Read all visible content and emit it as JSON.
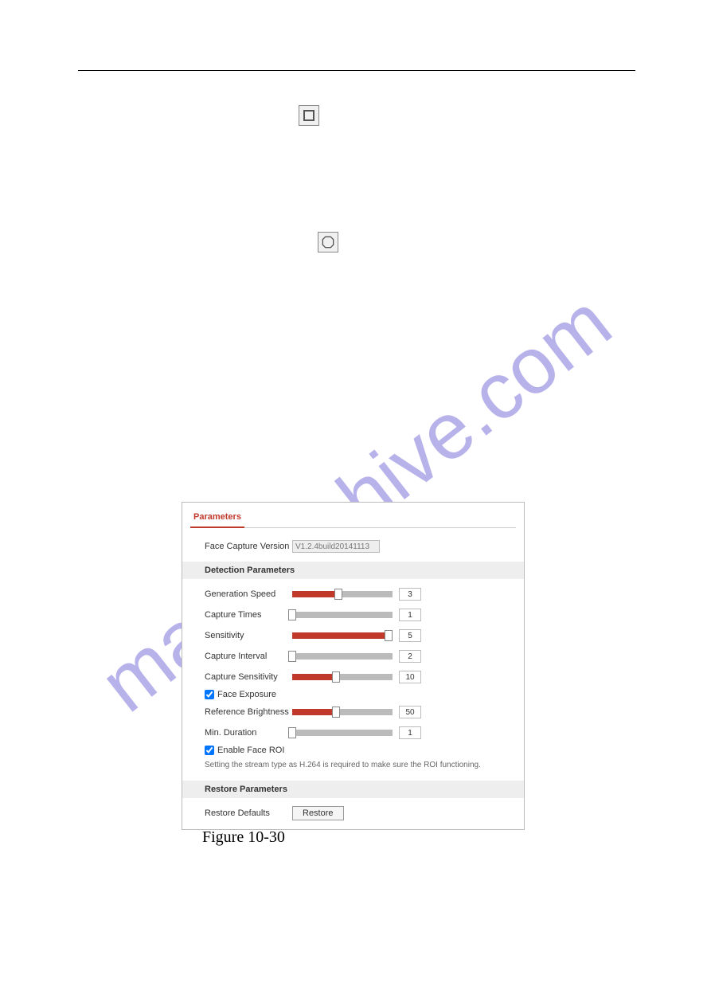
{
  "watermark": "manualshive.com",
  "icons": {
    "square_name": "stop-icon",
    "octagon_name": "octagon-icon"
  },
  "panel": {
    "tab_label": "Parameters",
    "version_label": "Face Capture Version",
    "version_value": "V1.2.4build20141113",
    "section_detection": "Detection Parameters",
    "section_restore": "Restore Parameters",
    "rows": {
      "generation_speed": {
        "label": "Generation Speed",
        "value": "3",
        "pct": 46
      },
      "capture_times": {
        "label": "Capture Times",
        "value": "1",
        "pct": 0
      },
      "sensitivity": {
        "label": "Sensitivity",
        "value": "5",
        "pct": 96
      },
      "capture_interval": {
        "label": "Capture Interval",
        "value": "2",
        "pct": 0
      },
      "capture_sensitivity": {
        "label": "Capture Sensitivity",
        "value": "10",
        "pct": 44
      },
      "reference_brightness": {
        "label": "Reference Brightness",
        "value": "50",
        "pct": 44
      },
      "min_duration": {
        "label": "Min. Duration",
        "value": "1",
        "pct": 0
      }
    },
    "face_exposure_label": "Face Exposure",
    "face_exposure_checked": true,
    "enable_face_roi_label": "Enable Face ROI",
    "enable_face_roi_checked": true,
    "note": "Setting the stream type as H.264 is required to make sure the ROI functioning.",
    "restore_defaults_label": "Restore Defaults",
    "restore_button": "Restore"
  },
  "figure_caption": "Figure 10-30"
}
